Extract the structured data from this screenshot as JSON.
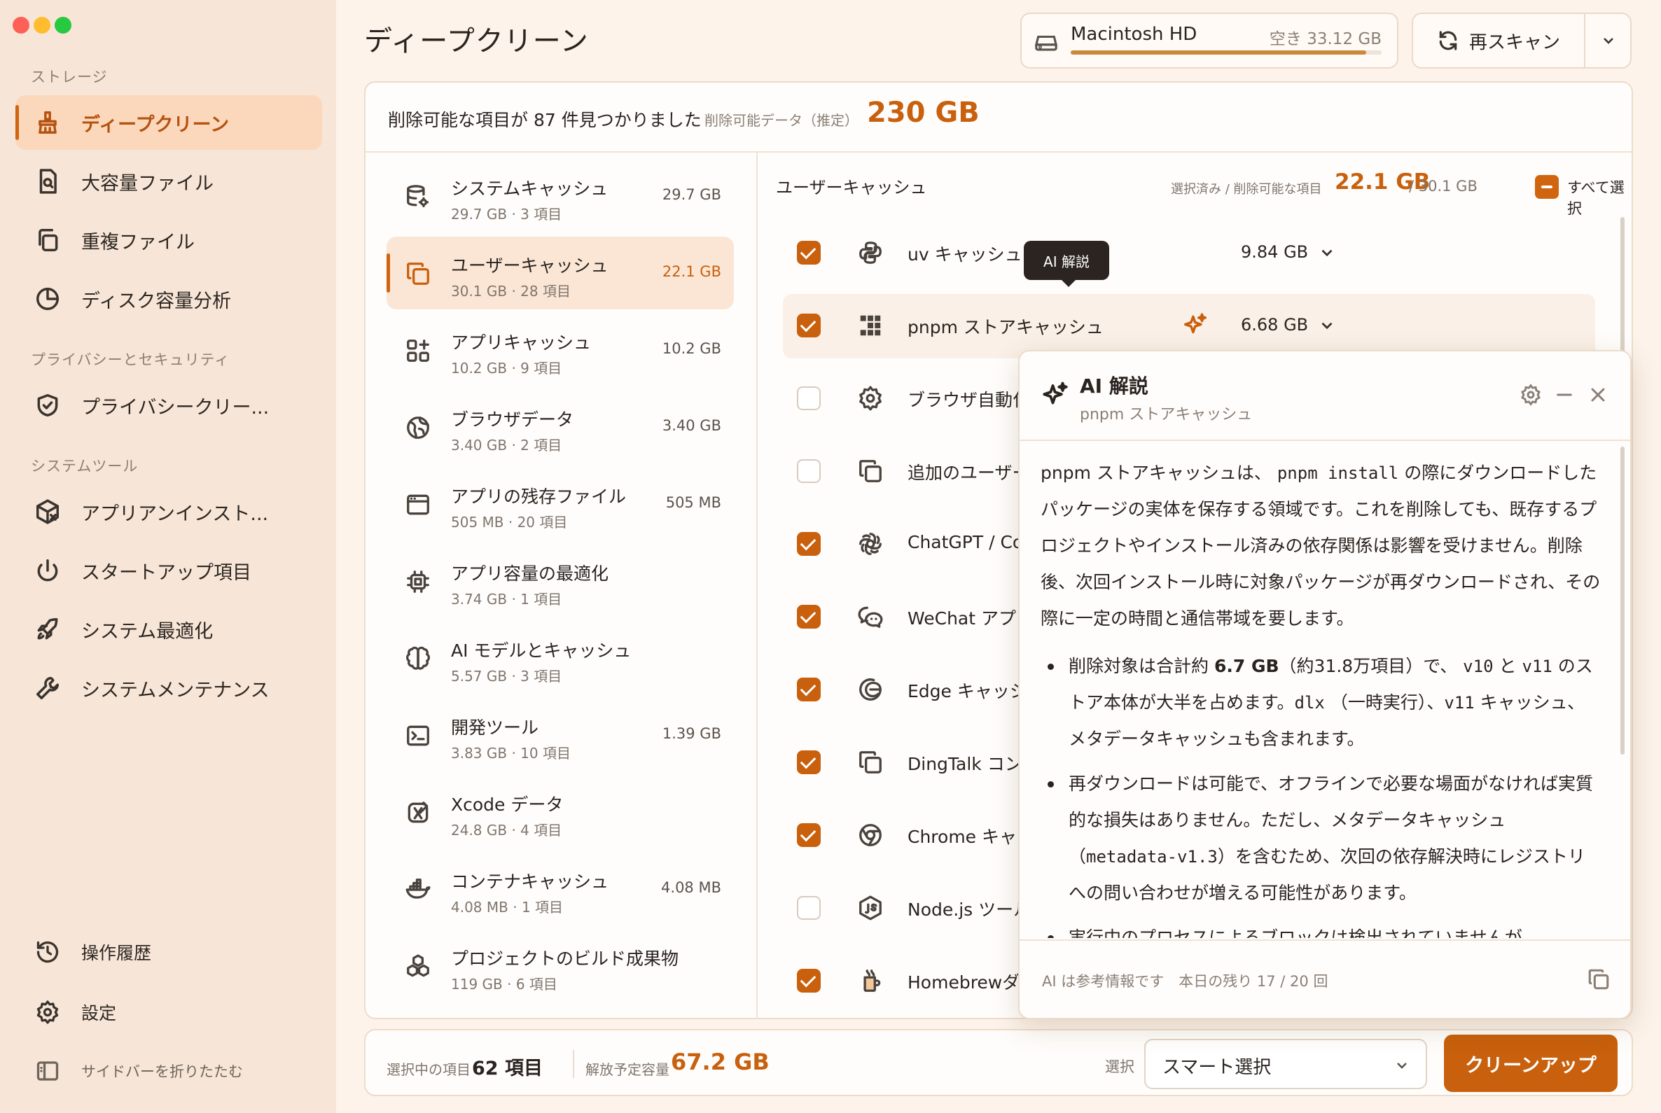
{
  "sidebar": {
    "sec_storage": "ストレージ",
    "sec_privacy": "プライバシーとセキュリティ",
    "sec_tools": "システムツール",
    "items": [
      {
        "label": "ディープクリーン"
      },
      {
        "label": "大容量ファイル"
      },
      {
        "label": "重複ファイル"
      },
      {
        "label": "ディスク容量分析"
      },
      {
        "label": "プライバシークリー..."
      },
      {
        "label": "アプリアンインスト..."
      },
      {
        "label": "スタートアップ項目"
      },
      {
        "label": "システム最適化"
      },
      {
        "label": "システムメンテナンス"
      }
    ],
    "footer": {
      "history": "操作履歴",
      "settings": "設定",
      "collapse": "サイドバーを折りたたむ"
    }
  },
  "header": {
    "title": "ディープクリーン",
    "disk_name": "Macintosh HD",
    "disk_free": "空き 33.12 GB",
    "disk_used_fraction": 0.95,
    "rescan_label": "再スキャン"
  },
  "summary": {
    "found": "削除可能な項目が 87 件見つかりました",
    "est_label": "削除可能データ（推定）",
    "est_value": "230 GB"
  },
  "categories": [
    {
      "name": "システムキャッシュ",
      "sub": "29.7 GB · 3 項目",
      "value": "29.7 GB",
      "icon": "database-gear-icon"
    },
    {
      "name": "ユーザーキャッシュ",
      "sub": "30.1 GB · 28 項目",
      "value": "22.1 GB",
      "icon": "copy-icon"
    },
    {
      "name": "アプリキャッシュ",
      "sub": "10.2 GB · 9 項目",
      "value": "10.2 GB",
      "icon": "grid-plus-icon"
    },
    {
      "name": "ブラウザデータ",
      "sub": "3.40 GB · 2 項目",
      "value": "3.40 GB",
      "icon": "globe-icon"
    },
    {
      "name": "アプリの残存ファイル",
      "sub": "505 MB · 20 項目",
      "value": "505 MB",
      "icon": "window-icon"
    },
    {
      "name": "アプリ容量の最適化",
      "sub": "3.74 GB · 1 項目",
      "value": "",
      "icon": "chip-icon"
    },
    {
      "name": "AI モデルとキャッシュ",
      "sub": "5.57 GB · 3 項目",
      "value": "",
      "icon": "brain-icon"
    },
    {
      "name": "開発ツール",
      "sub": "3.83 GB · 10 項目",
      "value": "1.39 GB",
      "icon": "terminal-icon"
    },
    {
      "name": "Xcode データ",
      "sub": "24.8 GB · 4 項目",
      "value": "",
      "icon": "xcode-icon"
    },
    {
      "name": "コンテナキャッシュ",
      "sub": "4.08 MB · 1 項目",
      "value": "4.08 MB",
      "icon": "docker-icon"
    },
    {
      "name": "プロジェクトのビルド成果物",
      "sub": "119 GB · 6 項目",
      "value": "",
      "icon": "cubes-icon"
    }
  ],
  "items_header": {
    "title": "ユーザーキャッシュ",
    "sel_label": "選択済み / 削除可能な項目",
    "sel_value": "22.1 GB",
    "total": "/ 30.1 GB",
    "select_all": "すべて選択"
  },
  "items": [
    {
      "name": "uv キャッシュ",
      "value": "9.84 GB",
      "checked": true
    },
    {
      "name": "pnpm ストアキャッシュ",
      "value": "6.68 GB",
      "checked": true
    },
    {
      "name": "ブラウザ自動化",
      "value": "",
      "checked": false
    },
    {
      "name": "追加のユーザー",
      "value": "",
      "checked": false
    },
    {
      "name": "ChatGPT / Co",
      "value": "",
      "checked": true
    },
    {
      "name": "WeChat アプリ",
      "value": "",
      "checked": true
    },
    {
      "name": "Edge キャッシ",
      "value": "",
      "checked": true
    },
    {
      "name": "DingTalk コン",
      "value": "",
      "checked": true
    },
    {
      "name": "Chrome キャッ",
      "value": "",
      "checked": true
    },
    {
      "name": "Node.js ツール",
      "value": "",
      "checked": false
    },
    {
      "name": "Homebrewダ",
      "value": "",
      "checked": true
    }
  ],
  "tooltip": "AI 解説",
  "ai": {
    "title": "AI 解説",
    "subtitle": "pnpm ストアキャッシュ",
    "p1a": "pnpm ストアキャッシュは、",
    "p1code": "pnpm install",
    "p1b": "の際にダウンロードしたパッケージの実体を保存する領域です。これを削除しても、既存するプロジェクトやインストール済みの依存関係は影響を受けません。削除後、次回インストール時に対象パッケージが再ダウンロードされ、その際に一定の時間と通信帯域を要します。",
    "b1a": "削除対象は合計約",
    "b1bold": "6.7 GB",
    "b1b": "（約31.8万項目）で、",
    "b1c1": "v10",
    "b1and": "と",
    "b1c2": "v11",
    "b1c": "のストア本体が大半を占めます。",
    "b1c3": "dlx",
    "b1d": "（一時実行）、",
    "b1c4": "v11",
    "b1e": "キャッシュ、メタデータキャッシュも含まれます。",
    "b2a": "再ダウンロードは可能で、オフラインで必要な場面がなければ実質的な損失はありません。ただし、メタデータキャッシュ（",
    "b2code": "metadata-v1.3",
    "b2b": "）を含むため、次回の依存解決時にレジストリへの問い合わせが増える可能性があります。",
    "b3": "実行中のプロセスによるブロックは検出されていませんが、",
    "footer": "AI は参考情報です　本日の残り 17 / 20 回"
  },
  "bottom": {
    "sel_label": "選択中の項目",
    "sel_value": "62 項目",
    "free_label": "解放予定容量",
    "free_value": "67.2 GB",
    "select_label": "選択",
    "select_value": "スマート選択",
    "clean": "クリーンアップ"
  }
}
